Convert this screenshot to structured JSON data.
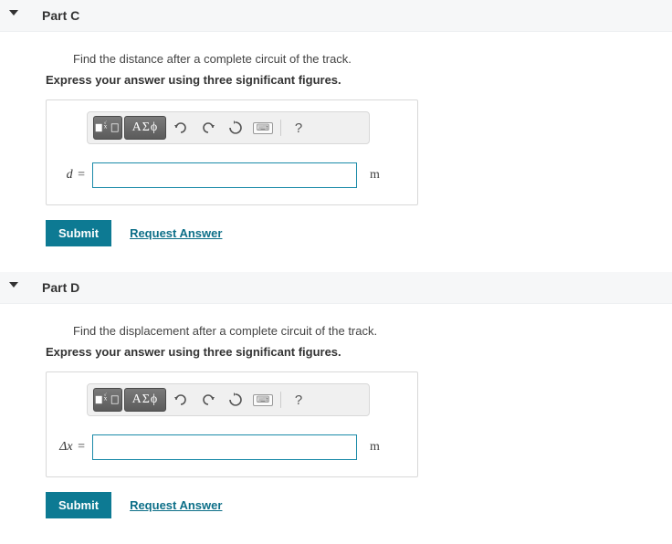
{
  "parts": [
    {
      "title": "Part C",
      "intro": "Find the distance after a complete circuit of the track.",
      "instructions": "Express your answer using three significant figures.",
      "variable_html": "<i>d</i>",
      "value": "",
      "unit": "m",
      "submit_label": "Submit",
      "request_label": "Request Answer"
    },
    {
      "title": "Part D",
      "intro": "Find the displacement after a complete circuit of the track.",
      "instructions": "Express your answer using three significant figures.",
      "variable_html": "&Delta;<i>x</i>",
      "value": "",
      "unit": "m",
      "submit_label": "Submit",
      "request_label": "Request Answer"
    }
  ],
  "toolbar": {
    "greek_label": "ΑΣϕ",
    "help_label": "?"
  }
}
